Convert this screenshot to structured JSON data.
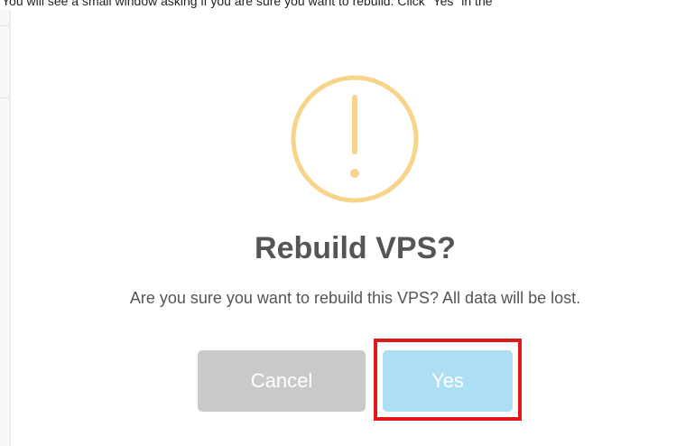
{
  "instruction_text": "You will see a small window asking if you are sure you want to rebuild. Click \"Yes\" in the",
  "dialog": {
    "icon": "exclamation-circle-icon",
    "icon_color": "#f8d38a",
    "title": "Rebuild VPS?",
    "message": "Are you sure you want to rebuild this VPS? All data will be lost.",
    "cancel_label": "Cancel",
    "confirm_label": "Yes"
  },
  "colors": {
    "cancel_button": "#c9c9c9",
    "confirm_button": "#acdff4",
    "highlight": "#e3161c",
    "text": "#555555"
  }
}
